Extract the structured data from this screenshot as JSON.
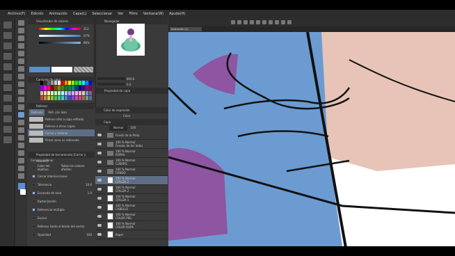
{
  "menu": [
    "Archivo(F)",
    "Edición",
    "Animación",
    "Capa(L)",
    "Seleccionar",
    "Ver",
    "Filtro",
    "Ventana(W)",
    "Ayuda(H)"
  ],
  "color_panel": {
    "title": "Visualizador de colores",
    "values": [
      "212",
      "67%",
      "86%"
    ]
  },
  "swatch_panel": {
    "title": "Conjunto de color"
  },
  "subtool_panel": {
    "tabs": [
      "Rellenar",
      "Rell. con lazo"
    ],
    "items": [
      "Relleno sólo a capa editada",
      "Relleno a otras capas",
      "Cerrar y rellenar",
      "Pintar zona no rellenada"
    ],
    "selected": 2
  },
  "tool_property": {
    "title": "Propiedad de herramienta [Cerrar y rellenar]",
    "subtitle": "Cerrar y rellenar",
    "rows": [
      {
        "label": "Color del objetivo",
        "value": "Todos los colores afectan",
        "checked": false
      },
      {
        "label": "Cerrar intersecciones",
        "value": "",
        "checked": true
      },
      {
        "label": "Tolerancia",
        "value": "10.0",
        "checked": false
      },
      {
        "label": "Escalado de área",
        "value": "1.0",
        "checked": true
      },
      {
        "label": "Rasterización",
        "value": "",
        "checked": false
      },
      {
        "label": "Referencia múltiple",
        "value": "",
        "checked": true
      },
      {
        "label": "Excluir",
        "value": "",
        "checked": false
      },
      {
        "label": "Rellenar hasta el borde del vector",
        "value": "",
        "checked": false
      },
      {
        "label": "Opacidad",
        "value": "100",
        "checked": false
      }
    ]
  },
  "navigator": {
    "title": "Navegador",
    "zoom": "800.0",
    "angle": "0.0",
    "subpanel": "Propiedad de capa"
  },
  "layer_panel": {
    "color_title": "Color de expresión",
    "color_value": "Color",
    "title": "Capa",
    "blend": "Normal",
    "opacity": "100",
    "layers": [
      {
        "name": "Fondo de la Pinta",
        "folder": true
      },
      {
        "name": "100 % Normal\nFondos de los lados",
        "folder": true
      },
      {
        "name": "100 % Normal\nROPAS",
        "folder": true
      },
      {
        "name": "100 % Normal\nCUERPO",
        "folder": true
      },
      {
        "name": "100 % Normal\nFONDO",
        "folder": true
      },
      {
        "name": "100 % Normal\nCFALDA 2",
        "folder": false,
        "selected": true
      },
      {
        "name": "100 % Normal\nCFALDA 2",
        "folder": false
      },
      {
        "name": "100 % Normal\nCFALDA 1",
        "folder": false
      },
      {
        "name": "100 % Normal\nCABELLO",
        "folder": false
      },
      {
        "name": "100 % Normal\nCOLOR PIEL",
        "folder": false
      },
      {
        "name": "100 % Normal\nCOLOR ROPA",
        "folder": false
      },
      {
        "name": "Papel",
        "folder": false
      }
    ]
  },
  "canvas": {
    "tab": "Ilustración (1)",
    "bg": "#ffffff",
    "blue": "#6b9bd1",
    "skin": "#e7c4b7",
    "purple": "#8e55a2"
  },
  "accent": "#6f9bd0"
}
